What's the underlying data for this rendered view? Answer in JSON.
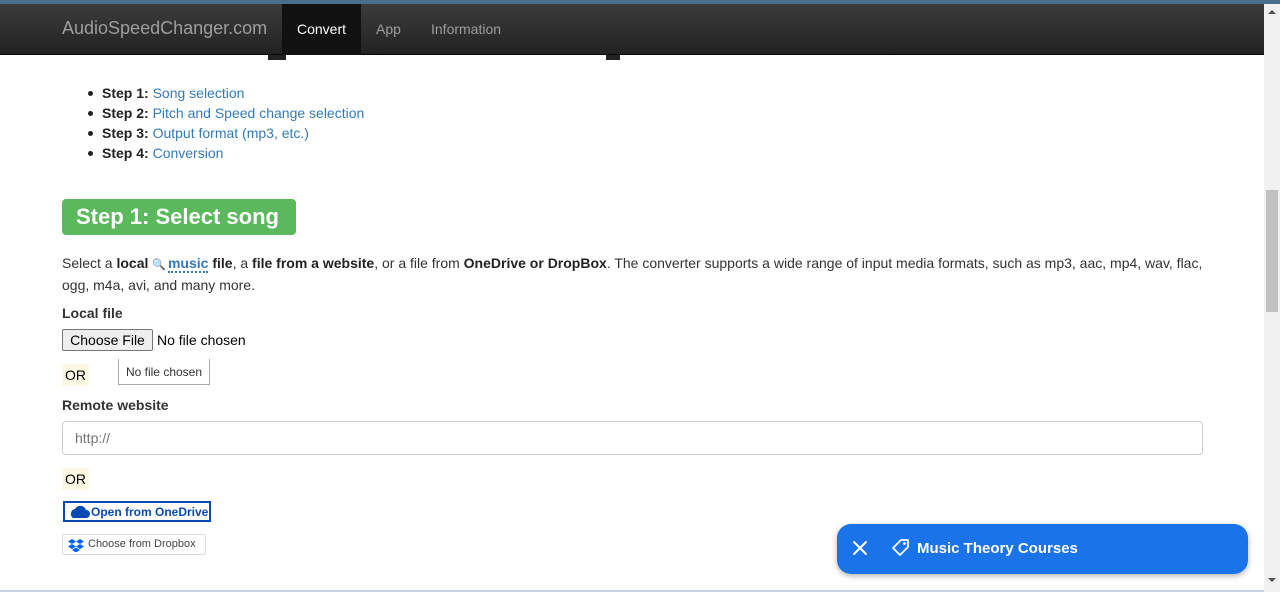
{
  "nav": {
    "brand": "AudioSpeedChanger.com",
    "items": [
      {
        "label": "Convert",
        "active": true
      },
      {
        "label": "App",
        "active": false
      },
      {
        "label": "Information",
        "active": false
      }
    ]
  },
  "steps": [
    {
      "prefix": "Step 1:",
      "link": "Song selection"
    },
    {
      "prefix": "Step 2:",
      "link": "Pitch and Speed change selection"
    },
    {
      "prefix": "Step 3:",
      "link": "Output format (mp3, etc.)"
    },
    {
      "prefix": "Step 4:",
      "link": "Conversion"
    }
  ],
  "step1": {
    "heading": "Step 1: Select song",
    "desc": {
      "t1": "Select a ",
      "b1": "local",
      "music": "music",
      "b2": " file",
      "t2": ", a ",
      "b3": "file from a website",
      "t3": ", or a file from ",
      "b4": "OneDrive or DropBox",
      "t4": ". The converter supports a wide range of input media formats, such as mp3, aac, mp4, wav, flac, ogg, m4a, avi, and many more."
    },
    "local_label": "Local file",
    "choose_file": "Choose File",
    "no_file": "No file chosen",
    "or": "OR",
    "no_file_box": "No file chosen",
    "remote_label": "Remote website",
    "url_placeholder": "http://",
    "onedrive": "Open from OneDrive",
    "dropbox": "Choose from Dropbox"
  },
  "promo": {
    "text": "Music Theory Courses",
    "color": "#1a73e8"
  },
  "colors": {
    "badge": "#5cb85c",
    "link": "#337ab7",
    "onedrive": "#094ab2",
    "or_bg": "#fcf8e3"
  }
}
